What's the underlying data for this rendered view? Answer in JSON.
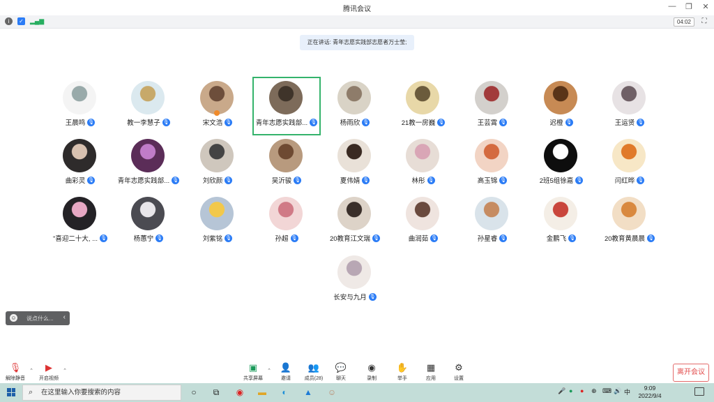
{
  "window": {
    "title": "腾讯会议"
  },
  "status": {
    "timer": "04:02"
  },
  "speaking_banner": "正在讲话: 青年志愿实践部志愿者万士莹;",
  "participants": [
    {
      "name": "王晨鸣",
      "bg": "#f4f4f4",
      "fg": "#9aa"
    },
    {
      "name": "教一李慧子",
      "bg": "#dbe9ef",
      "fg": "#c7a96a"
    },
    {
      "name": "宋文浩",
      "bg": "#c9a98a",
      "fg": "#6d4e3b"
    },
    {
      "name": "青年志愿实践部...",
      "bg": "#7d6b5a",
      "fg": "#3f342a"
    },
    {
      "name": "杨雨欣",
      "bg": "#d9d3c6",
      "fg": "#8e7c6a"
    },
    {
      "name": "21教一房巍",
      "bg": "#e8d8a8",
      "fg": "#6b5b3c"
    },
    {
      "name": "王芸霄",
      "bg": "#d3d0cc",
      "fg": "#a23b3b"
    },
    {
      "name": "迟橙",
      "bg": "#c78a54",
      "fg": "#5a3418"
    },
    {
      "name": "王运贤",
      "bg": "#e7e2e4",
      "fg": "#6f6066"
    },
    {
      "name": "曲彩灵",
      "bg": "#2e2b2b",
      "fg": "#d8c1b0"
    },
    {
      "name": "青年志愿实践部...",
      "bg": "#5b2d58",
      "fg": "#c07cc8"
    },
    {
      "name": "刘欣颜",
      "bg": "#cfc7bd",
      "fg": "#444"
    },
    {
      "name": "吴沂骏",
      "bg": "#b89a7e",
      "fg": "#6e4a32"
    },
    {
      "name": "夏伟婧",
      "bg": "#e9e1d8",
      "fg": "#3a2a22"
    },
    {
      "name": "林彤",
      "bg": "#e7ddd6",
      "fg": "#d9a6b6"
    },
    {
      "name": "高玉锦",
      "bg": "#f2d4c4",
      "fg": "#d46a3f"
    },
    {
      "name": "2班5组徐嘉",
      "bg": "#0e0e0e",
      "fg": "#ffffff"
    },
    {
      "name": "闫红晔",
      "bg": "#f7e7c6",
      "fg": "#e07a2a"
    },
    {
      "name": "\"喜迎二十大, ...",
      "bg": "#242226",
      "fg": "#e7a8c4"
    },
    {
      "name": "杨蕙宁",
      "bg": "#4b4b52",
      "fg": "#e8e6ea"
    },
    {
      "name": "刘紫铭",
      "bg": "#b6c5d6",
      "fg": "#f2c84b"
    },
    {
      "name": "孙超",
      "bg": "#f2d6d6",
      "fg": "#d07a86"
    },
    {
      "name": "20教育江文瑞",
      "bg": "#ddd3c8",
      "fg": "#3a2f2a"
    },
    {
      "name": "曲润茹",
      "bg": "#efe4df",
      "fg": "#6a4a3e"
    },
    {
      "name": "孙星睿",
      "bg": "#d9e3ea",
      "fg": "#c68c62"
    },
    {
      "name": "金鹏飞",
      "bg": "#f4eee6",
      "fg": "#c9463c"
    },
    {
      "name": "20教育黄晨晨",
      "bg": "#f2dec5",
      "fg": "#d9893f"
    },
    {
      "name": "长安与九月",
      "bg": "#efe9e6",
      "fg": "#b8a7b4"
    }
  ],
  "chat": {
    "placeholder": "说点什么..."
  },
  "toolbar": {
    "unmute": "解除静音",
    "start_video": "开启视频",
    "share_screen": "共享屏幕",
    "invite": "邀请",
    "members": "成员(28)",
    "chat": "聊天",
    "record": "录制",
    "raise_hand": "举手",
    "apps": "应用",
    "settings": "设置",
    "leave": "离开会议"
  },
  "taskbar": {
    "search_placeholder": "在这里输入你要搜索的内容",
    "ime": "中",
    "time": "9:09",
    "date": "2022/9/4"
  }
}
